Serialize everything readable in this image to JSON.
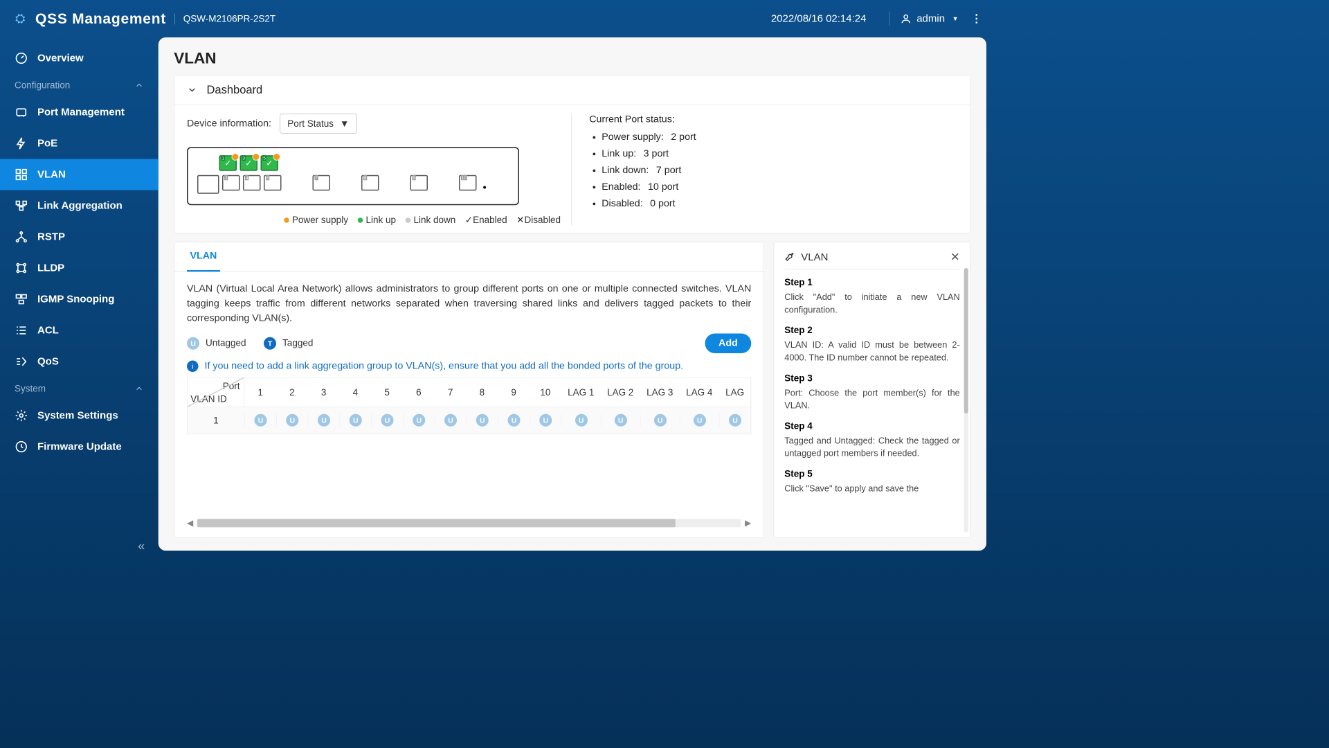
{
  "app": {
    "title": "QSS Management",
    "model": "QSW-M2106PR-2S2T"
  },
  "header": {
    "datetime": "2022/08/16 02:14:24",
    "user": "admin"
  },
  "sidebar": {
    "overview": "Overview",
    "group_config": "Configuration",
    "items": [
      "Port Management",
      "PoE",
      "VLAN",
      "Link Aggregation",
      "RSTP",
      "LLDP",
      "IGMP Snooping",
      "ACL",
      "QoS"
    ],
    "group_system": "System",
    "system_items": [
      "System Settings",
      "Firmware Update"
    ]
  },
  "page": {
    "title": "VLAN"
  },
  "dashboard": {
    "title": "Dashboard",
    "devinfo_label": "Device information:",
    "devinfo_value": "Port Status",
    "legend": {
      "power": "Power supply",
      "up": "Link up",
      "down": "Link down",
      "enabled": "Enabled",
      "disabled": "Disabled"
    },
    "status": {
      "title": "Current Port status:",
      "rows": [
        {
          "label": "Power supply:",
          "value": "2 port"
        },
        {
          "label": "Link up:",
          "value": "3 port"
        },
        {
          "label": "Link down:",
          "value": "7 port"
        },
        {
          "label": "Enabled:",
          "value": "10 port"
        },
        {
          "label": "Disabled:",
          "value": "0 port"
        }
      ]
    }
  },
  "vlan": {
    "tab": "VLAN",
    "desc": "VLAN (Virtual Local Area Network) allows administrators to group different ports on one or multiple connected switches. VLAN tagging keeps traffic from different networks separated when traversing shared links and delivers tagged packets to their corresponding VLAN(s).",
    "untagged": "Untagged",
    "tagged": "Tagged",
    "add": "Add",
    "info": "If you need to add a link aggregation group to VLAN(s), ensure that you add all the bonded ports of the group.",
    "col_vlanid": "VLAN ID",
    "col_port": "Port",
    "ports": [
      "1",
      "2",
      "3",
      "4",
      "5",
      "6",
      "7",
      "8",
      "9",
      "10",
      "LAG 1",
      "LAG 2",
      "LAG 3",
      "LAG 4",
      "LAG"
    ],
    "row_vlan": "1"
  },
  "help": {
    "title": "VLAN",
    "steps": [
      {
        "h": "Step 1",
        "t": "Click \"Add\" to initiate a new VLAN configuration."
      },
      {
        "h": "Step 2",
        "t": "VLAN ID: A valid ID must be between 2-4000. The ID number cannot be repeated."
      },
      {
        "h": "Step 3",
        "t": "Port: Choose the port member(s) for the VLAN."
      },
      {
        "h": "Step 4",
        "t": "Tagged and Untagged: Check the tagged or untagged port members if needed."
      },
      {
        "h": "Step 5",
        "t": "Click \"Save\" to apply and save the"
      }
    ]
  }
}
